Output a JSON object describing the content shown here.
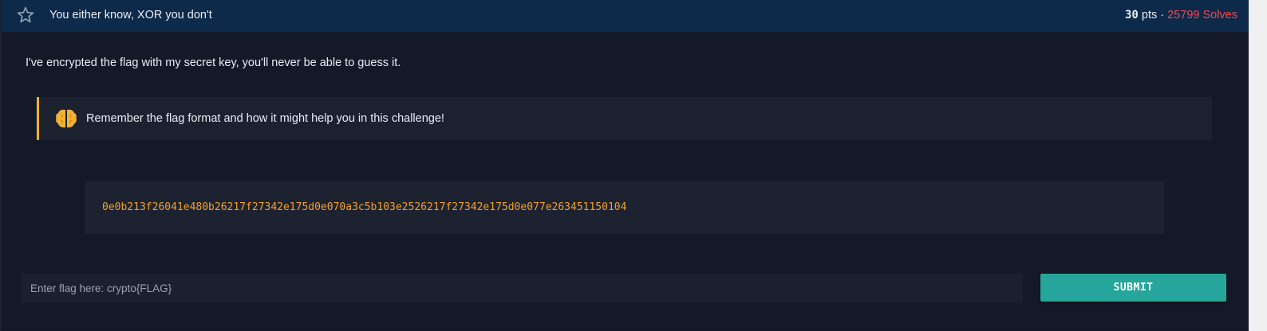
{
  "challenge": {
    "title": "You either know, XOR you don't",
    "points_value": "30",
    "points_suffix": " pts · ",
    "solves": "25799 Solves",
    "description": "I've encrypted the flag with my secret key, you'll never be able to guess it.",
    "hint": {
      "icon": "brain-icon",
      "text": "Remember the flag format and how it might help you in this challenge!"
    },
    "ciphertext": "0e0b213f26041e480b26217f27342e175d0e070a3c5b103e2526217f27342e175d0e077e263451150104"
  },
  "submission": {
    "placeholder": "Enter flag here: crypto{FLAG}",
    "value": "",
    "submit_label": "SUBMIT"
  },
  "colors": {
    "header_bg": "#0d2a4a",
    "page_bg": "#131927",
    "accent_orange": "#f4b233",
    "ciphertext_color": "#f3a02b",
    "solves_color": "#ec4a5a",
    "submit_bg": "#26a69a"
  },
  "icons": {
    "favorite": "star-icon",
    "hint": "brain-icon"
  }
}
